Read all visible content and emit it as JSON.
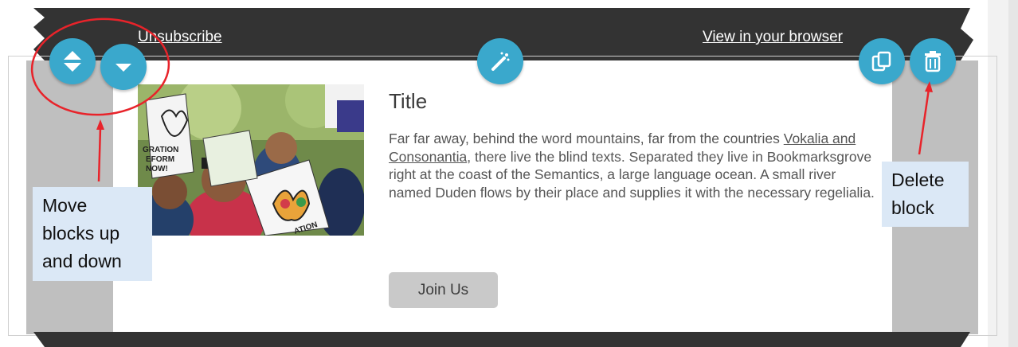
{
  "header": {
    "unsubscribe_label": "Unsubscribe",
    "view_in_browser_label": "View in your browser"
  },
  "block": {
    "title": "Title",
    "paragraph_part1": "Far far away, behind the word mountains, far from the countries ",
    "paragraph_link": "Vokalia and Consonantia",
    "paragraph_part2": ", there live the blind texts. Separated they live in Bookmarksgrove right at the coast of the Semantics, a large language ocean. A small river named Duden flows by their place and supplies it with the necessary regelialia.",
    "button_label": "Join Us",
    "image_sign_text_1": "GRATION",
    "image_sign_text_2": "EFORM",
    "image_sign_text_3": "NOW!",
    "image_sign_text_4": "ATION"
  },
  "toolbar": {
    "move_icon": "up-down-arrows-icon",
    "move_down_icon": "chevron-down-icon",
    "edit_icon": "magic-wand-icon",
    "duplicate_icon": "duplicate-icon",
    "delete_icon": "trash-icon"
  },
  "annotations": {
    "move_label_line1": "Move",
    "move_label_line2": "blocks up",
    "move_label_line3": "and down",
    "delete_label_line1": "Delete",
    "delete_label_line2": "block"
  },
  "colors": {
    "ribbon": "#333333",
    "accent": "#3aa8cc",
    "side_panel": "#bfbfbf",
    "annotation_bg": "#dbe8f6",
    "annotation_line": "#e8232a"
  }
}
